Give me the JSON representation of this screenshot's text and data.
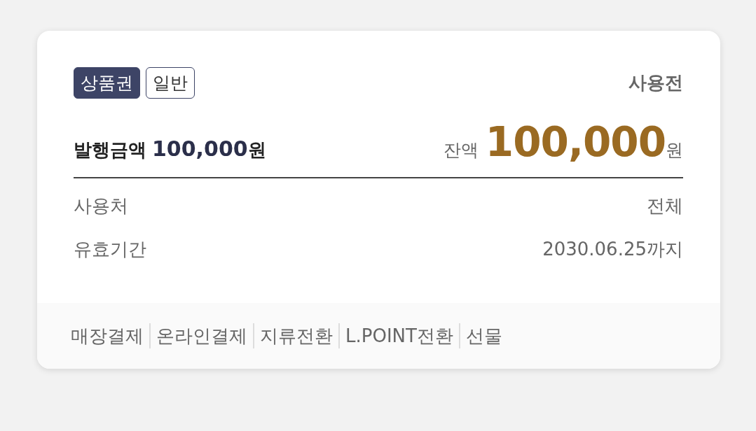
{
  "card": {
    "badges": [
      {
        "label": "상품권",
        "kind": "filled"
      },
      {
        "label": "일반",
        "kind": "outline"
      }
    ],
    "status": "사용전",
    "issue": {
      "label": "발행금액",
      "amount": "100,000",
      "unit": "원"
    },
    "balance": {
      "label": "잔액",
      "amount": "100,000",
      "unit": "원"
    },
    "details": [
      {
        "label": "사용처",
        "value": "전체"
      },
      {
        "label": "유효기간",
        "value": "2030.06.25까지"
      }
    ],
    "actions": [
      "매장결제",
      "온라인결제",
      "지류전환",
      "L.POINT전환",
      "선물"
    ]
  }
}
